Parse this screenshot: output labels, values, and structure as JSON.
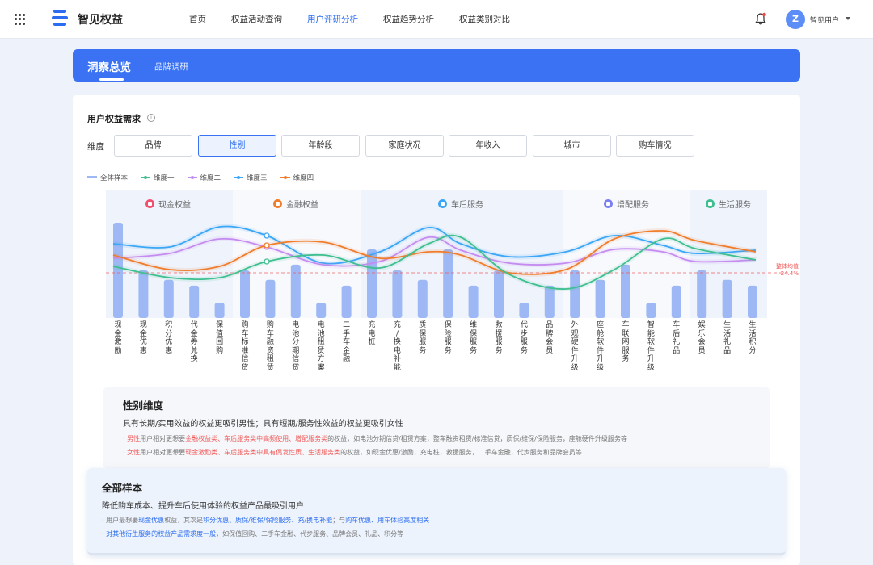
{
  "app": {
    "name": "智见权益"
  },
  "nav": {
    "items": [
      "首页",
      "权益活动查询",
      "用户评研分析",
      "权益趋势分析",
      "权益类别对比"
    ],
    "active_index": 2
  },
  "user": {
    "avatar_letter": "Z",
    "name": "智见用户"
  },
  "hero": {
    "title": "洞察总览",
    "tab2": "品牌调研"
  },
  "section": {
    "title": "用户权益需求",
    "dimension_label": "维度"
  },
  "dimensions": {
    "items": [
      "品牌",
      "性别",
      "年龄段",
      "家庭状况",
      "年收入",
      "城市",
      "购车情况"
    ],
    "selected_index": 1
  },
  "legend": [
    "全体样本",
    "维度一",
    "维度二",
    "维度三",
    "维度四"
  ],
  "colors": {
    "accent": "#3a72f3",
    "bar": "#9db8f5",
    "dim1": "#3fbf8f",
    "dim2": "#c58cf0",
    "dim3": "#3aa6f5",
    "dim4": "#f07d2b",
    "avg": "#f05a5a"
  },
  "categories": [
    {
      "name": "现金权益",
      "icon": "cash-icon",
      "color": "#f0506e"
    },
    {
      "name": "金融权益",
      "icon": "finance-icon",
      "color": "#f07d2b"
    },
    {
      "name": "车后服务",
      "icon": "car-service-icon",
      "color": "#3aa6f5"
    },
    {
      "name": "增配服务",
      "icon": "upgrade-icon",
      "color": "#7b7ff0"
    },
    {
      "name": "生活服务",
      "icon": "life-icon",
      "color": "#3fbf8f"
    }
  ],
  "chart_data": {
    "type": "bar",
    "categories": [
      "现金激励",
      "现金优惠",
      "积分优惠",
      "代金券兑换",
      "保值回购",
      "购车标准信贷",
      "购车融资租赁",
      "电池分期信贷",
      "电池租赁方案",
      "二手车金融",
      "充电桩",
      "充/换电补能",
      "质保服务",
      "保险服务",
      "维保服务",
      "救援服务",
      "代步服务",
      "品牌会员",
      "外观硬件升级",
      "座舱软件升级",
      "车联网服务",
      "智能软件升级",
      "车后礼品",
      "娱乐会员",
      "生活礼品",
      "生活积分"
    ],
    "series": [
      {
        "name": "全体样本",
        "values": [
          50,
          25,
          20,
          17,
          8,
          25,
          20,
          28,
          8,
          17,
          36,
          25,
          20,
          36,
          17,
          25,
          8,
          17,
          25,
          20,
          28,
          8,
          17,
          25,
          20,
          17
        ]
      }
    ],
    "lines": [
      "维度一",
      "维度二",
      "维度三",
      "维度四"
    ],
    "avg_line": {
      "label": "整体均值",
      "value": "24.4%"
    },
    "legend": "top-left",
    "grid": false
  },
  "insight": {
    "title": "性别维度",
    "subtitle": "具有长期/实用效益的权益更吸引男性；具有短期/服务性效益的权益更吸引女性",
    "line1_a": "· 男性",
    "line1_b": "用户相对更想要",
    "line1_c": "金融权益类、车后服务类中高频使用、增配服务类",
    "line1_d": "的权益，如电池分期信贷/租赁方案，整车融资租赁/标准信贷，质保/维保/保险服务，座舱硬件升级服务等",
    "line2_a": "· 女性",
    "line2_b": "用户相对更想要",
    "line2_c": "现金激励类、车后服务类中具有偶发性质、生活服务类",
    "line2_d": "的权益，如现金优惠/激励，充电桩，救援服务，二手车金融，代步服务和品牌会员等"
  },
  "summary": {
    "title": "全部样本",
    "subtitle": "降低购车成本、提升车后使用体验的权益产品最吸引用户",
    "line1_a": "· 用户最想要",
    "line1_b": "现金优惠",
    "line1_c": "权益，其次是",
    "line1_d": "积分优惠、质保/维保/保险服务、充/换电补能",
    "line1_e": "；与",
    "line1_f": "购车优惠、用车体验高度相关",
    "line2_a": "· 对其他衍生服务的权益产品需求度一般",
    "line2_b": "，如保值回购、二手车金融、代步服务、品牌会员、礼品、积分等"
  }
}
